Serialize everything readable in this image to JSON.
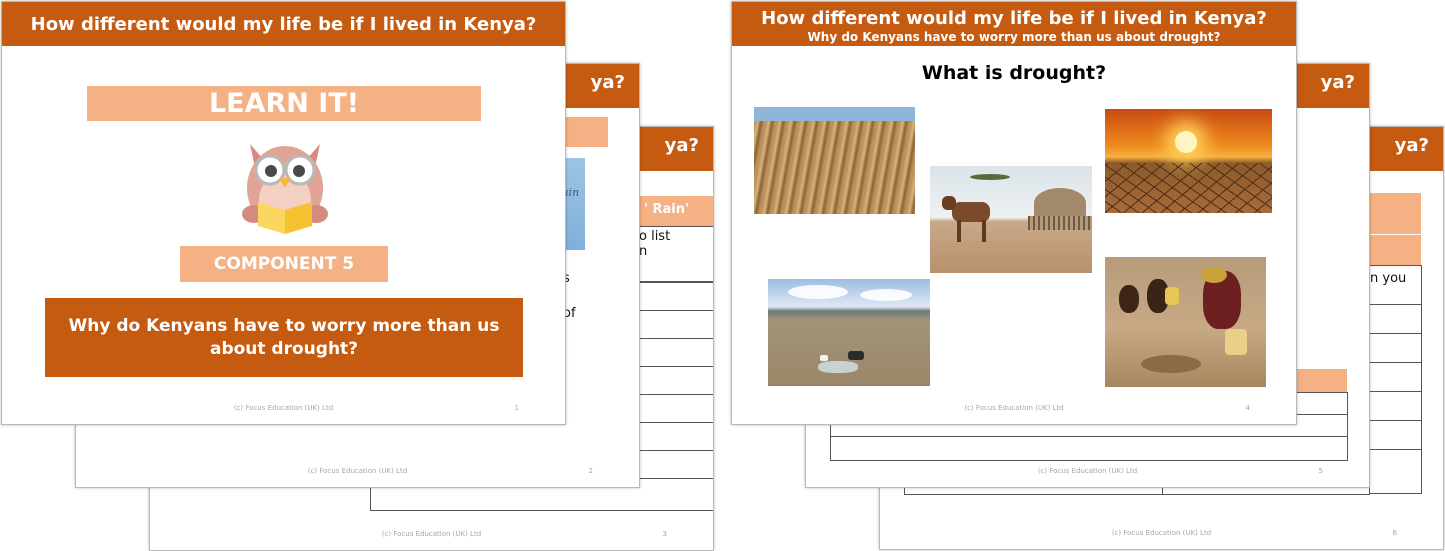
{
  "slides": {
    "s1": {
      "title": "How different would my life be if I lived in Kenya?",
      "learn": "LEARN IT!",
      "component": "COMPONENT 5",
      "question": "Why do Kenyans have to worry more than us about drought?",
      "footer": "(c) Focus Education (UK) Ltd",
      "num": "1"
    },
    "s2": {
      "title_tail": "ya?",
      "book_word": "ain",
      "footer": "(c) Focus Education (UK) Ltd",
      "num": "2",
      "frag_s": "s",
      "frag_of": "of"
    },
    "s3": {
      "title_tail": "ya?",
      "header": "' Rain'",
      "line1": "o list",
      "line2": "n",
      "footer": "(c) Focus Education (UK) Ltd",
      "num": "3"
    },
    "s4": {
      "title": "How different would my life be if I lived in Kenya?",
      "subtitle": "Why do Kenyans have to worry more than us about drought?",
      "heading": "What is drought?",
      "footer": "(c) Focus Education (UK) Ltd",
      "num": "4"
    },
    "s5": {
      "title_tail": "ya?",
      "footer": "(c) Focus Education (UK) Ltd",
      "num": "5"
    },
    "s6": {
      "title_tail": "ya?",
      "line1": "n you",
      "footer": "(c) Focus Education (UK) Ltd",
      "num": "6"
    }
  }
}
